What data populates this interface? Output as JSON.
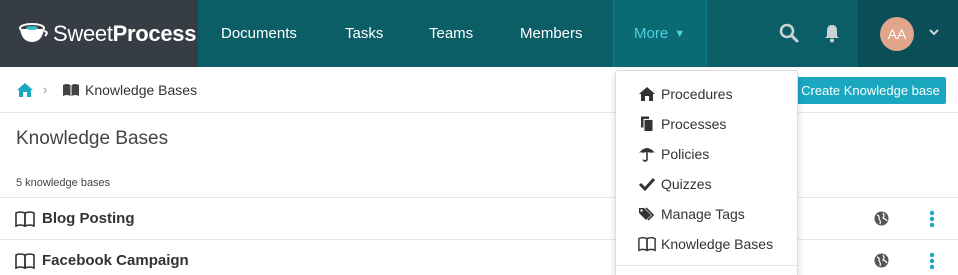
{
  "brand": {
    "name_light": "Sweet",
    "name_bold": "Process"
  },
  "nav": {
    "items": [
      {
        "label": "Documents"
      },
      {
        "label": "Tasks"
      },
      {
        "label": "Teams"
      },
      {
        "label": "Members"
      }
    ],
    "more_label": "More",
    "user_initials": "AA"
  },
  "breadcrumb": {
    "current": "Knowledge Bases"
  },
  "actions": {
    "create_label": "Create Knowledge base"
  },
  "page": {
    "title": "Knowledge Bases",
    "count_text": "5 knowledge bases"
  },
  "rows": [
    {
      "title": "Blog Posting"
    },
    {
      "title": "Facebook Campaign"
    }
  ],
  "more_menu": {
    "items": [
      {
        "label": "Procedures",
        "icon": "home-icon"
      },
      {
        "label": "Processes",
        "icon": "files-icon"
      },
      {
        "label": "Policies",
        "icon": "umbrella-icon"
      },
      {
        "label": "Quizzes",
        "icon": "check-icon"
      },
      {
        "label": "Manage Tags",
        "icon": "tags-icon"
      },
      {
        "label": "Knowledge Bases",
        "icon": "book-icon"
      }
    ]
  },
  "colors": {
    "nav_bg": "#0b5d66",
    "brand_bg": "#373d45",
    "accent": "#1aa7c0",
    "more_active": "#4fd1e0",
    "avatar_bg": "#e0a58b"
  }
}
